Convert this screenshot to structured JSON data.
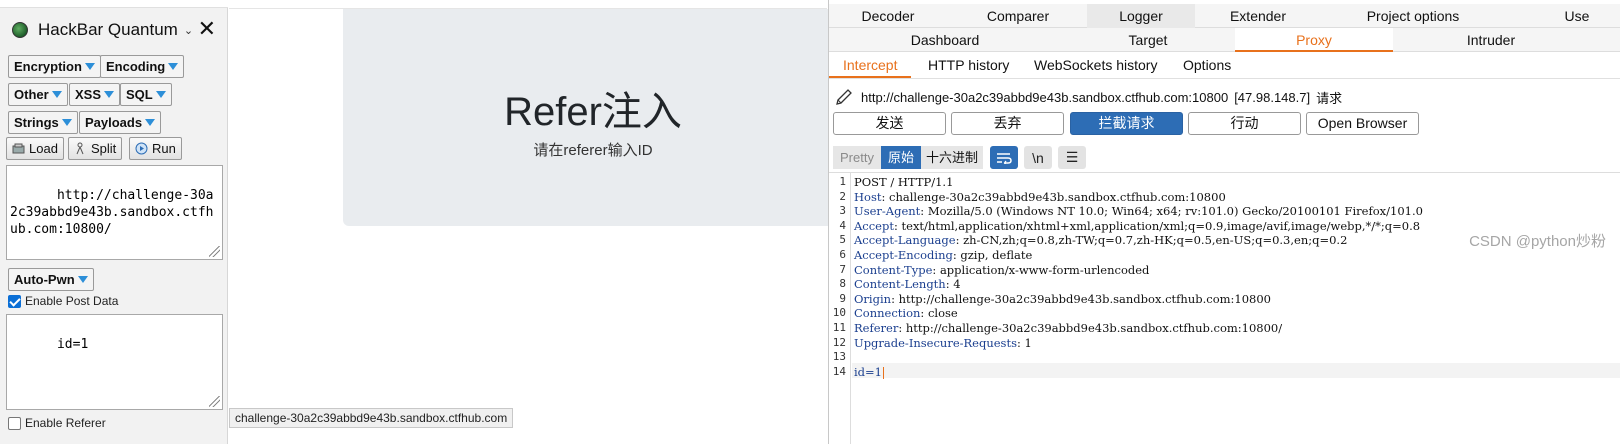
{
  "hackbar": {
    "title": "HackBar Quantum",
    "menus": {
      "encryption": "Encryption",
      "encoding": "Encoding",
      "other": "Other",
      "xss": "XSS",
      "sql": "SQL",
      "strings": "Strings",
      "payloads": "Payloads",
      "auto_pwn": "Auto-Pwn"
    },
    "actions": {
      "load": "Load",
      "split": "Split",
      "run": "Run"
    },
    "url_value": "http://challenge-30a2c39abbd9e43b.sandbox.ctfhub.com:10800/",
    "enable_post_label": "Enable Post Data",
    "enable_post_checked": true,
    "post_value": "id=1",
    "enable_referer_label": "Enable Referer",
    "enable_referer_checked": false
  },
  "page": {
    "title": "Refer注入",
    "subtitle": "请在referer输入ID",
    "status_url": "challenge-30a2c39abbd9e43b.sandbox.ctfhub.com"
  },
  "burp": {
    "tabs_row1": [
      "Decoder",
      "Comparer",
      "Logger",
      "Extender",
      "Project options",
      "Use"
    ],
    "tabs_row2": [
      "Dashboard",
      "Target",
      "Proxy",
      "Intruder"
    ],
    "subtabs": [
      "Intercept",
      "HTTP history",
      "WebSockets history",
      "Options"
    ],
    "request_line": {
      "url": "http://challenge-30a2c39abbd9e43b.sandbox.ctfhub.com:10800",
      "ip": "[47.98.148.7]",
      "label": "请求"
    },
    "buttons": {
      "forward": "发送",
      "drop": "丢弃",
      "intercept": "拦截请求",
      "action": "行动",
      "open_browser": "Open Browser"
    },
    "view_modes": [
      "Pretty",
      "原始",
      "十六进制"
    ],
    "newline_label": "\\n",
    "request_lines": [
      {
        "k": "",
        "v": "POST / HTTP/1.1"
      },
      {
        "k": "Host",
        "v": "challenge-30a2c39abbd9e43b.sandbox.ctfhub.com:10800"
      },
      {
        "k": "User-Agent",
        "v": "Mozilla/5.0 (Windows NT 10.0; Win64; x64; rv:101.0) Gecko/20100101 Firefox/101.0"
      },
      {
        "k": "Accept",
        "v": "text/html,application/xhtml+xml,application/xml;q=0.9,image/avif,image/webp,*/*;q=0.8"
      },
      {
        "k": "Accept-Language",
        "v": "zh-CN,zh;q=0.8,zh-TW;q=0.7,zh-HK;q=0.5,en-US;q=0.3,en;q=0.2"
      },
      {
        "k": "Accept-Encoding",
        "v": "gzip, deflate"
      },
      {
        "k": "Content-Type",
        "v": "application/x-www-form-urlencoded"
      },
      {
        "k": "Content-Length",
        "v": "4"
      },
      {
        "k": "Origin",
        "v": "http://challenge-30a2c39abbd9e43b.sandbox.ctfhub.com:10800"
      },
      {
        "k": "Connection",
        "v": "close"
      },
      {
        "k": "Referer",
        "v": "http://challenge-30a2c39abbd9e43b.sandbox.ctfhub.com:10800/"
      },
      {
        "k": "Upgrade-Insecure-Requests",
        "v": "1"
      },
      {
        "k": "",
        "v": ""
      },
      {
        "k": "",
        "v": "id=1",
        "body": true
      }
    ],
    "accent_color": "#e8711c",
    "primary_color": "#2d6db5"
  },
  "watermark": "CSDN @python炒粉"
}
